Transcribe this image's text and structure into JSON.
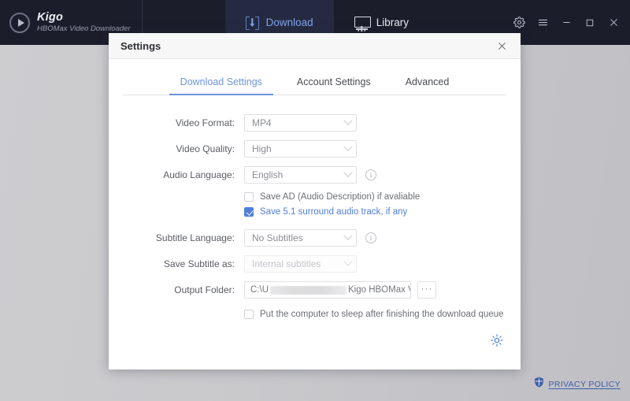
{
  "app": {
    "brand_name": "Kigo",
    "brand_subtitle": "HBOMax Video Downloader",
    "logo_icon": "play-circle-icon",
    "nav": [
      {
        "label": "Download",
        "icon": "download-bracket-icon",
        "active": true
      },
      {
        "label": "Library",
        "icon": "monitor-icon",
        "active": false
      }
    ],
    "window_controls": [
      {
        "name": "gear-icon",
        "glyph": "⚙"
      },
      {
        "name": "hamburger-menu-icon",
        "glyph": "☰"
      },
      {
        "name": "minimize-icon",
        "glyph": "–"
      },
      {
        "name": "maximize-icon",
        "glyph": "□"
      },
      {
        "name": "close-icon",
        "glyph": "✕"
      }
    ]
  },
  "dialog": {
    "title": "Settings",
    "close_glyph": "✕",
    "tabs": [
      {
        "label": "Download Settings",
        "active": true
      },
      {
        "label": "Account Settings",
        "active": false
      },
      {
        "label": "Advanced",
        "active": false
      }
    ],
    "fields": {
      "video_format": {
        "label": "Video Format:",
        "value": "MP4"
      },
      "video_quality": {
        "label": "Video Quality:",
        "value": "High"
      },
      "audio_language": {
        "label": "Audio Language:",
        "value": "English",
        "info": "i"
      },
      "subtitle_language": {
        "label": "Subtitle Language:",
        "value": "No Subtitles",
        "info": "i"
      },
      "save_subtitle_as": {
        "label": "Save Subtitle as:",
        "value": "Internal subtitles",
        "disabled": true
      },
      "output_folder": {
        "label": "Output Folder:",
        "value_prefix": "C:\\U",
        "value_suffix": "Kigo HBOMax Vide",
        "browse_label": "···"
      }
    },
    "checkboxes": {
      "save_ad": {
        "label": "Save AD (Audio Description) if avaliable",
        "checked": false
      },
      "save_surround": {
        "label": "Save 5.1 surround audio track, if any",
        "checked": true
      },
      "sleep_after": {
        "label": "Put the computer to sleep after finishing the download queue",
        "checked": false
      }
    },
    "tip_icon": "lightbulb-icon"
  },
  "footer": {
    "privacy_label": "PRIVACY POLICY",
    "privacy_icon": "shield-icon"
  },
  "colors": {
    "accent_blue": "#4f7fdb",
    "tab_blue": "#6d93dd",
    "titlebar_dark": "#1b1d2b",
    "nav_active_bg": "#252a42",
    "link_blue": "#3f5fa8"
  }
}
